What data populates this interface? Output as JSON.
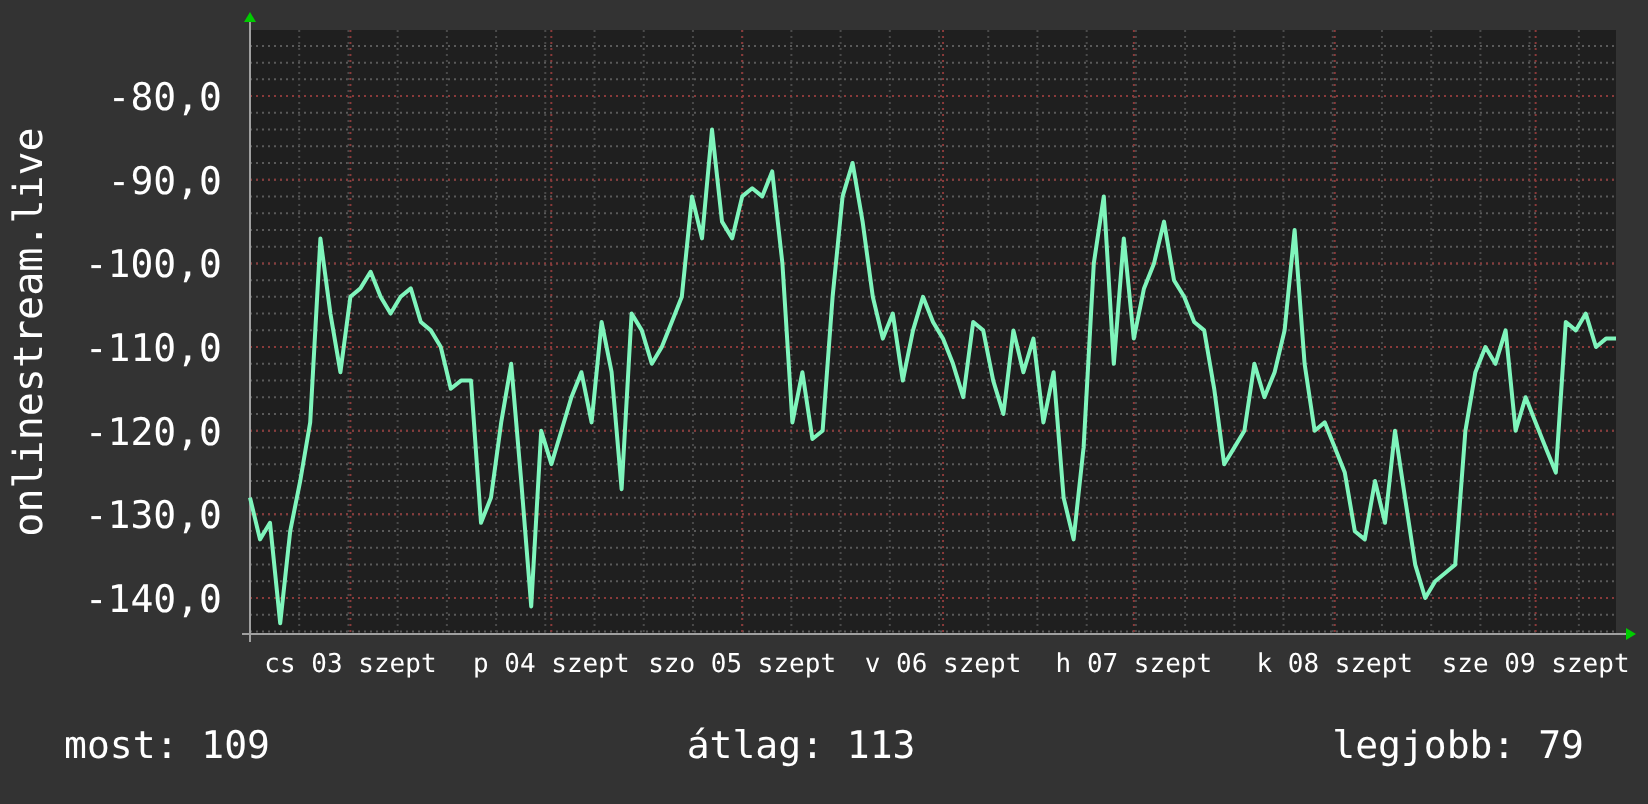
{
  "chart": {
    "chart_data": {
      "type": "line",
      "ylabel": "onlinestream.live",
      "grid": true,
      "categories": [
        null,
        null,
        null,
        null,
        null,
        null,
        null,
        null,
        null,
        null,
        "cs 03 szept",
        null,
        null,
        null,
        null,
        null,
        null,
        null,
        null,
        null,
        null,
        null,
        null,
        null,
        null,
        null,
        null,
        null,
        null,
        null,
        "p 04 szept",
        null,
        null,
        null,
        null,
        null,
        null,
        null,
        null,
        null,
        null,
        null,
        null,
        null,
        null,
        null,
        null,
        null,
        null,
        "szo 05 szept",
        null,
        null,
        null,
        null,
        null,
        null,
        null,
        null,
        null,
        null,
        null,
        null,
        null,
        null,
        null,
        null,
        null,
        null,
        null,
        "v 06 szept",
        null,
        null,
        null,
        null,
        null,
        null,
        null,
        null,
        null,
        null,
        null,
        null,
        null,
        null,
        null,
        null,
        null,
        null,
        "h 07 szept",
        null,
        null,
        null,
        null,
        null,
        null,
        null,
        null,
        null,
        null,
        null,
        null,
        null,
        null,
        null,
        null,
        null,
        null,
        null,
        "k 08 szept",
        null,
        null,
        null,
        null,
        null,
        null,
        null,
        null,
        null,
        null,
        null,
        null,
        null,
        null,
        null,
        null,
        null,
        null,
        null,
        "sze 09 szept",
        null,
        null,
        null,
        null,
        null,
        null,
        null,
        null
      ],
      "ylim": [
        -144.3,
        -72.1
      ],
      "yticks": [
        {
          "value": -80,
          "label": "-80,0"
        },
        {
          "value": -90,
          "label": "-90,0"
        },
        {
          "value": -100,
          "label": "-100,0"
        },
        {
          "value": -110,
          "label": "-110,0"
        },
        {
          "value": -120,
          "label": "-120,0"
        },
        {
          "value": -130,
          "label": "-130,0"
        },
        {
          "value": -140,
          "label": "-140,0"
        }
      ],
      "series": [
        {
          "color": "#7ff5bc",
          "values": [
            -128,
            -133,
            -131,
            -143,
            -132,
            -126,
            -119,
            -97,
            -106,
            -113,
            -104,
            -103,
            -101,
            -104,
            -106,
            -104,
            -103,
            -107,
            -108,
            -110,
            -115,
            -114,
            -114,
            -131,
            -128,
            -119,
            -112,
            -126,
            -141,
            -120,
            -124,
            -120,
            -116,
            -113,
            -119,
            -107,
            -113,
            -127,
            -106,
            -108,
            -112,
            -110,
            -107,
            -104,
            -92,
            -97,
            -84,
            -95,
            -97,
            -92,
            -91,
            -92,
            -89,
            -100,
            -119,
            -113,
            -121,
            -120,
            -104,
            -92,
            -88,
            -95,
            -104,
            -109,
            -106,
            -114,
            -108,
            -104,
            -107,
            -109,
            -112,
            -116,
            -107,
            -108,
            -114,
            -118,
            -108,
            -113,
            -109,
            -119,
            -113,
            -128,
            -133,
            -122,
            -100,
            -92,
            -112,
            -97,
            -109,
            -103,
            -100,
            -95,
            -102,
            -104,
            -107,
            -108,
            -115,
            -124,
            -122,
            -120,
            -112,
            -116,
            -113,
            -108,
            -96,
            -112,
            -120,
            -119,
            -122,
            -125,
            -132,
            -133,
            -126,
            -131,
            -120,
            -128,
            -136,
            -140,
            -138,
            -137,
            -136,
            -120,
            -113,
            -110,
            -112,
            -108,
            -120,
            -116,
            -119,
            -122,
            -125,
            -107,
            -108,
            -106,
            -110,
            -109,
            -109
          ]
        }
      ]
    }
  },
  "legend": [
    {
      "label": "most: 109"
    },
    {
      "label": "átlag: 113"
    },
    {
      "label": "legjobb: 79"
    }
  ]
}
